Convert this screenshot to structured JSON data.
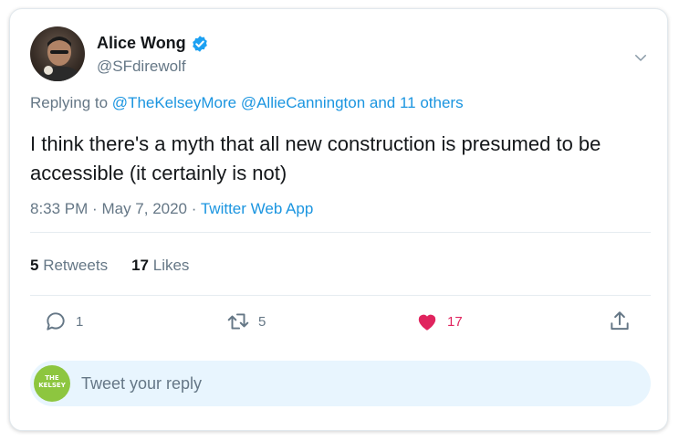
{
  "author": {
    "name": "Alice Wong",
    "handle": "@SFdirewolf"
  },
  "replying": {
    "prefix": "Replying to",
    "mentions": "@TheKelseyMore @AllieCannington and 11 others"
  },
  "tweet": {
    "text": "I think there's a myth that all new construction is presumed to be accessible (it certainly is not)",
    "time": "8:33 PM",
    "date": "May 7, 2020",
    "source": "Twitter Web App"
  },
  "stats": {
    "retweets_count": "5",
    "retweets_label": "Retweets",
    "likes_count": "17",
    "likes_label": "Likes"
  },
  "actions": {
    "reply_count": "1",
    "retweet_count": "5",
    "like_count": "17"
  },
  "reply_box": {
    "placeholder": "Tweet your reply",
    "avatar_text": "THE KELSEY"
  },
  "colors": {
    "accent": "#1b95e0",
    "like": "#e0245e",
    "muted": "#657786",
    "reply_bg": "#e8f5fe"
  }
}
